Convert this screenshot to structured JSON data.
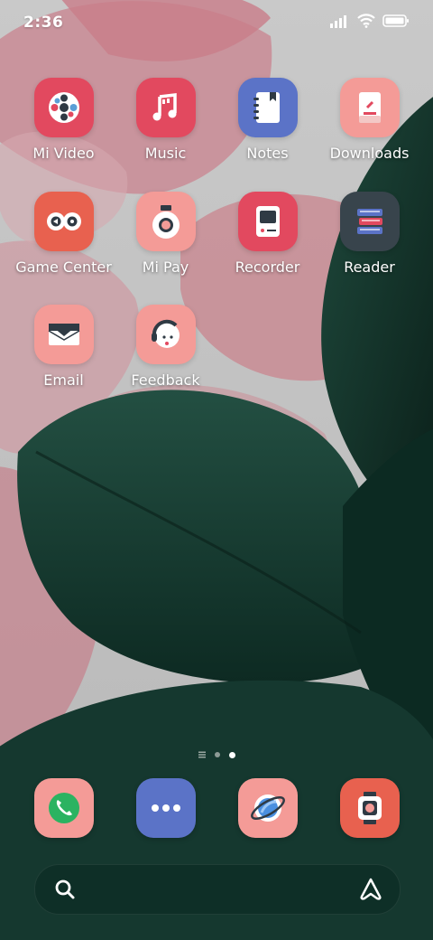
{
  "status_bar": {
    "time": "2:36",
    "icons": [
      "cellular-signal-icon",
      "wifi-icon",
      "battery-icon"
    ]
  },
  "apps": [
    {
      "label": "Mi Video",
      "icon": "mi-video-icon",
      "color": "#E2495F"
    },
    {
      "label": "Music",
      "icon": "music-icon",
      "color": "#E2495F"
    },
    {
      "label": "Notes",
      "icon": "notes-icon",
      "color": "#5B73C7"
    },
    {
      "label": "Downloads",
      "icon": "downloads-icon",
      "color": "#F49B97"
    },
    {
      "label": "Game Center",
      "icon": "game-center-icon",
      "color": "#E8614F"
    },
    {
      "label": "Mi Pay",
      "icon": "mi-pay-icon",
      "color": "#F49B97"
    },
    {
      "label": "Recorder",
      "icon": "recorder-icon",
      "color": "#E2495F"
    },
    {
      "label": "Reader",
      "icon": "reader-icon",
      "color": "#38444C"
    },
    {
      "label": "Email",
      "icon": "email-icon",
      "color": "#F49B97"
    },
    {
      "label": "Feedback",
      "icon": "feedback-icon",
      "color": "#F49B97"
    }
  ],
  "page_indicator": {
    "current_page": 2,
    "total_pages": 2,
    "icons": [
      "app-list-icon",
      "page-dot-icon",
      "page-dot-icon"
    ]
  },
  "dock": [
    {
      "icon": "phone-icon",
      "color": "#F49B97"
    },
    {
      "icon": "messaging-icon",
      "color": "#5B73C7"
    },
    {
      "icon": "browser-icon",
      "color": "#F49B97"
    },
    {
      "icon": "camera-icon",
      "color": "#E8614F"
    }
  ],
  "search_bar": {
    "left_icon": "search-icon",
    "right_icon": "assistant-icon"
  }
}
